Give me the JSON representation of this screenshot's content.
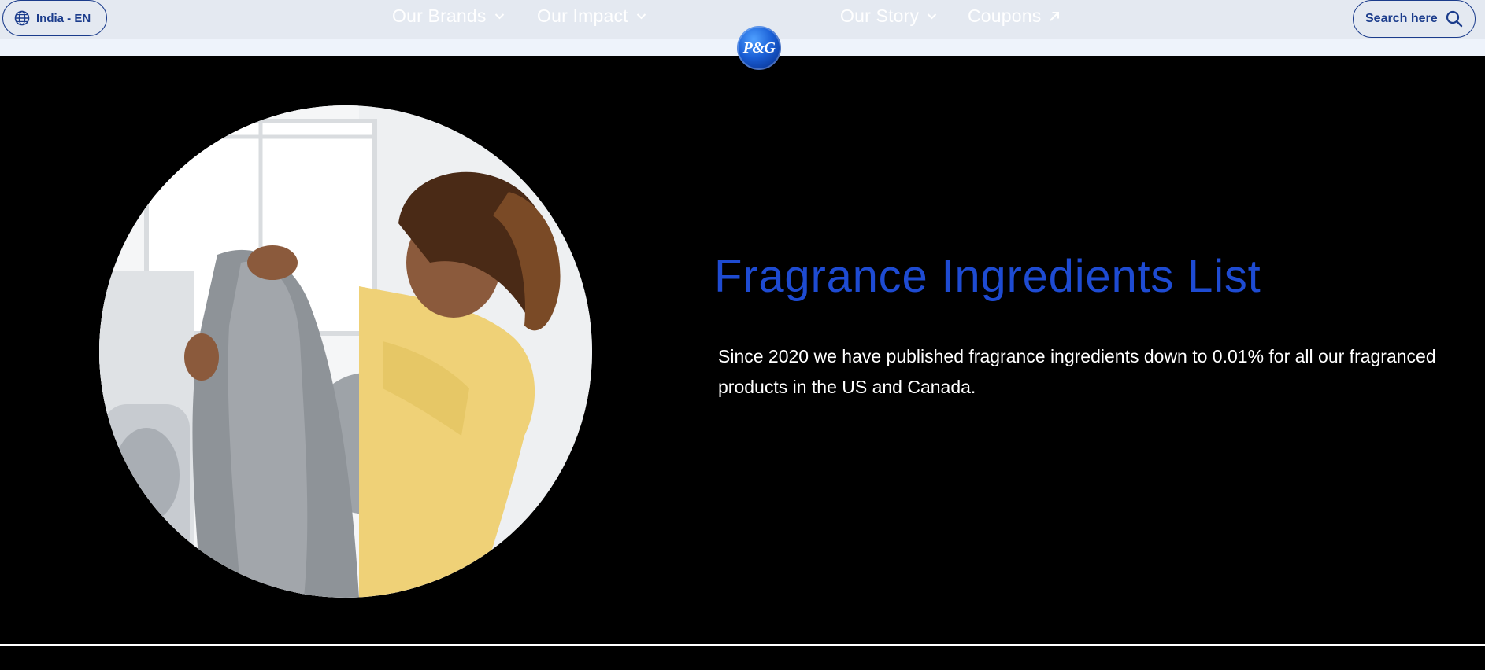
{
  "header": {
    "locale_label": "India - EN",
    "nav": [
      {
        "label": "Our Brands"
      },
      {
        "label": "Our Impact"
      },
      {
        "label": "Our Story"
      },
      {
        "label": "Coupons"
      }
    ],
    "search_label": "Search here",
    "logo_text": "P&G"
  },
  "hero": {
    "title": "Fragrance Ingredients List",
    "description": "Since 2020 we have published fragrance ingredients down to 0.01% for all our fragranced products in the US and Canada."
  },
  "colors": {
    "accent": "#1e4bd2",
    "nav_outline": "#1b3c8c",
    "topbar_bg": "#e4e9f1",
    "page_bg": "#000000"
  },
  "icons": {
    "locale": "globe-icon",
    "nav_dropdown": "chevron-down-icon",
    "external": "arrow-up-right-icon",
    "search": "search-icon"
  }
}
